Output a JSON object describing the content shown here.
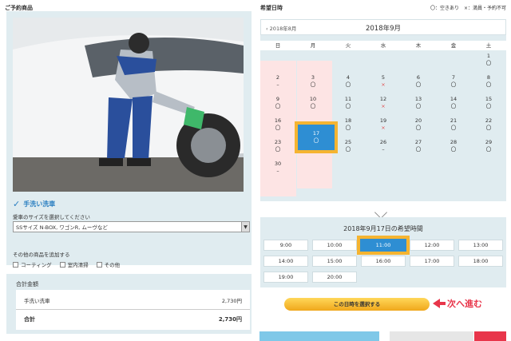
{
  "left": {
    "title": "ご予約商品",
    "service": "手洗い洗車",
    "size_label": "愛車のサイズを選択してください",
    "size_value": "SSサイズ N-BOX, ワゴンR, ムーヴなど",
    "extra_label": "その他の商品を追加する",
    "options": [
      "コーティング",
      "室内清掃",
      "その他"
    ],
    "total_title": "合計金額",
    "line_item": "手洗い洗車",
    "line_price": "2,730円",
    "total_label": "合計",
    "total_price": "2,730円"
  },
  "calendar": {
    "title": "希望日時",
    "legend": "〇：空きあり　×：満員・予約不可",
    "prev": "2018年8月",
    "month": "2018年9月",
    "weekdays": [
      "日",
      "月",
      "火",
      "水",
      "木",
      "金",
      "土"
    ],
    "days": [
      {
        "d": "1",
        "m": "〇",
        "c": 6,
        "r": 0
      },
      {
        "d": "2",
        "m": "–",
        "c": 0,
        "r": 1
      },
      {
        "d": "3",
        "m": "〇",
        "c": 1,
        "r": 1
      },
      {
        "d": "4",
        "m": "〇",
        "c": 2,
        "r": 1
      },
      {
        "d": "5",
        "m": "×",
        "c": 3,
        "r": 1
      },
      {
        "d": "6",
        "m": "〇",
        "c": 4,
        "r": 1
      },
      {
        "d": "7",
        "m": "〇",
        "c": 5,
        "r": 1
      },
      {
        "d": "8",
        "m": "〇",
        "c": 6,
        "r": 1
      },
      {
        "d": "9",
        "m": "〇",
        "c": 0,
        "r": 2
      },
      {
        "d": "10",
        "m": "〇",
        "c": 1,
        "r": 2
      },
      {
        "d": "11",
        "m": "〇",
        "c": 2,
        "r": 2
      },
      {
        "d": "12",
        "m": "×",
        "c": 3,
        "r": 2
      },
      {
        "d": "13",
        "m": "〇",
        "c": 4,
        "r": 2
      },
      {
        "d": "14",
        "m": "〇",
        "c": 5,
        "r": 2
      },
      {
        "d": "15",
        "m": "〇",
        "c": 6,
        "r": 2
      },
      {
        "d": "16",
        "m": "〇",
        "c": 0,
        "r": 3
      },
      {
        "d": "17",
        "m": "〇",
        "c": 1,
        "r": 3
      },
      {
        "d": "18",
        "m": "〇",
        "c": 2,
        "r": 3
      },
      {
        "d": "19",
        "m": "×",
        "c": 3,
        "r": 3
      },
      {
        "d": "20",
        "m": "〇",
        "c": 4,
        "r": 3
      },
      {
        "d": "21",
        "m": "〇",
        "c": 5,
        "r": 3
      },
      {
        "d": "22",
        "m": "〇",
        "c": 6,
        "r": 3
      },
      {
        "d": "23",
        "m": "〇",
        "c": 0,
        "r": 4
      },
      {
        "d": "24",
        "m": "〇",
        "c": 1,
        "r": 4
      },
      {
        "d": "25",
        "m": "〇",
        "c": 2,
        "r": 4
      },
      {
        "d": "26",
        "m": "–",
        "c": 3,
        "r": 4
      },
      {
        "d": "27",
        "m": "〇",
        "c": 4,
        "r": 4
      },
      {
        "d": "28",
        "m": "〇",
        "c": 5,
        "r": 4
      },
      {
        "d": "29",
        "m": "〇",
        "c": 6,
        "r": 4
      },
      {
        "d": "30",
        "m": "–",
        "c": 0,
        "r": 5
      }
    ],
    "selected_day": "17"
  },
  "time": {
    "title": "2018年9月17日の希望時間",
    "slots": [
      "9:00",
      "10:00",
      "11:00",
      "12:00",
      "13:00",
      "14:00",
      "15:00",
      "16:00",
      "17:00",
      "18:00",
      "19:00",
      "20:00"
    ],
    "selected": "11:00"
  },
  "cta": {
    "label": "この日時を選択する",
    "next": "次へ進む"
  },
  "colors": {
    "accent": "#2e8ed3",
    "highlight": "#f5b431",
    "cta": "#f0a71b",
    "note": "#e8354a"
  }
}
